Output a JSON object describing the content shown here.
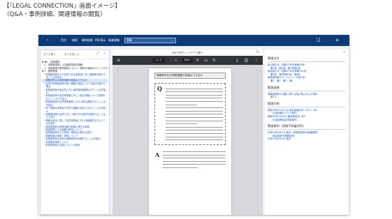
{
  "caption": {
    "line1": "【『LEGAL CONNECTION』画面イメージ】",
    "line2": "（Q&A・事例詳細、関連情報の閲覧）"
  },
  "topbar": {
    "back_icon": "chevron-left-icon",
    "nav": [
      "目次",
      "検索",
      "事例検索",
      "PDF表示",
      "事業情報"
    ],
    "select_value": "書籍",
    "bookmark_icon": "bookmark-icon",
    "menu_icon": "menu-icon"
  },
  "left_panel": {
    "expand_label": "全てを開く",
    "collapse_label": "全てを閉じる",
    "tree": [
      {
        "text": "▼ 第1　総則規程",
        "kind": "head"
      },
      {
        "text": "　1　事業者団体による獲得事業の範囲",
        "kind": "head"
      },
      {
        "text": "　2　事業者等が業界団体について一般的な指導を行うことができる場合",
        "kind": "head"
      },
      {
        "text": "▼ 2　獲得事業",
        "kind": "head"
      },
      {
        "text": "・事業者団体がその会員である事業者に対し価格等を提示することは可能か",
        "kind": "link"
      },
      {
        "text": "・価格前年比の制限措置の実施はできるか",
        "kind": "link",
        "selected": true
      },
      {
        "text": "・会員が事業者団体の統一価格の設定について指示を受けた場合",
        "kind": "link"
      },
      {
        "text": "・事業者団体が組合員に対し最低販売価格を示すことは可能か",
        "kind": "link"
      },
      {
        "text": "・事業者団体が会員事業者に対して適正価格について説明を行うことができるか",
        "kind": "link"
      },
      {
        "text": "・事業者団体が会員事業者間における受注調整を行うことは可能か",
        "kind": "link"
      },
      {
        "text": "・同一業種の事業者が共同で顧客の割当てを行うことは可能か",
        "kind": "link"
      },
      {
        "text": "・事業者団体の会員に対して取引先の選択を制限することはできるか",
        "kind": "link"
      },
      {
        "text": "・価格の設定に関して会員事業者に対し情報提供をすることは可能か",
        "kind": "link"
      },
      {
        "text": "・構成事業者の事業活動の制限に関する事例",
        "kind": "link"
      },
      {
        "text": "・数量制限による価格の維持について",
        "kind": "link"
      },
      {
        "text": "・事業者団体が行う研修・講習会の際の注意点",
        "kind": "link"
      },
      {
        "text": "・価格情報の収集・提供について",
        "kind": "link"
      },
      {
        "text": "・事業者団体が会員の設備投資を制限することは可能か",
        "kind": "link"
      },
      {
        "text": "・共同販売事業について",
        "kind": "link"
      },
      {
        "text": "・事業者団体の活動についての指針",
        "kind": "link"
      }
    ]
  },
  "viewer": {
    "header": "PDFを別ウィンドウで開く",
    "pin_icon": "pin-icon",
    "page_current": "1",
    "page_total": "3",
    "zoom": "84%",
    "menu_icon": "menu-icon",
    "zoom_out_icon": "minus-icon",
    "zoom_in_icon": "plus-icon",
    "fit_icon": "fit-page-icon",
    "rotate_icon": "rotate-icon",
    "download_icon": "download-icon",
    "print_icon": "print-icon",
    "more_icon": "more-icon",
    "doc_title": "価格前年比の制限措置の実施はできるか",
    "q_mark": "Q",
    "a_mark": "A"
  },
  "right_panel": {
    "collapse_icon": "double-chevron-right-icon",
    "sections": [
      {
        "title": "関連法令",
        "items": [
          {
            "text": "独占禁止法（昭和22年法律第54号）",
            "indent": false
          },
          {
            "text": "第3条（第2項）第2条第6項",
            "indent": true
          },
          {
            "text": "景品表示法（昭和37年法律第134号）",
            "indent": false
          },
          {
            "text": "第4条　第5条第1項　第6条",
            "indent": true
          },
          {
            "text": "事業者団体ガイドライン（平成7年）",
            "indent": false
          },
          {
            "text": "第1　第2　第3　第4",
            "indent": true
          }
        ]
      },
      {
        "title": "関連通達",
        "items": [
          {
            "text": "事業者団体の活動に関する独占禁止法上の指針",
            "indent": false
          },
          {
            "text": "第2-1",
            "indent": true
          }
        ]
      },
      {
        "title": "関連判例",
        "items": [
          {
            "text": "昭和49年11月22日 東京高裁判決（行ケ）1号",
            "indent": false
          },
          {
            "text": "（石油価格カルテル事件）",
            "indent": true
          },
          {
            "text": "昭和59年2月24日 最高裁判決（刑）",
            "indent": false
          },
          {
            "text": "（石油価格協定刑事事件）",
            "indent": true
          }
        ]
      },
      {
        "title": "関連事例（国税不服審判所）",
        "items": [
          {
            "text": "平成24年2月7日 裁決（事業者団体の価格制限）",
            "indent": false
          },
          {
            "text": "（東京国税不服審判所）",
            "indent": true
          },
          {
            "text": "平成27年9月1日 裁決",
            "indent": false
          }
        ]
      }
    ]
  }
}
